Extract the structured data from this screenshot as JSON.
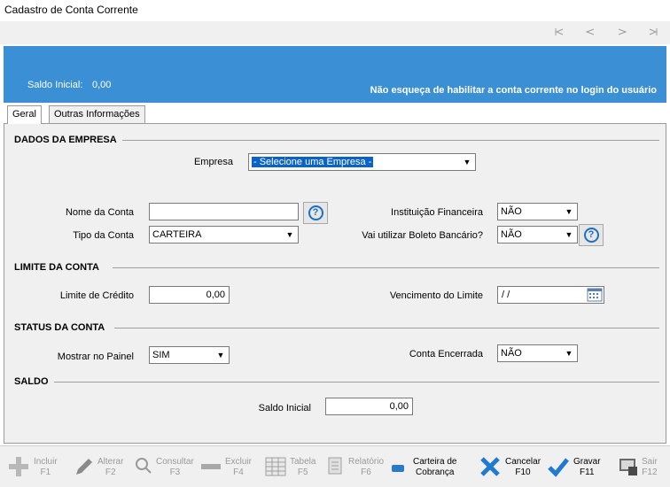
{
  "window": {
    "title": "Cadastro de Conta Corrente"
  },
  "navigation": {
    "icons": [
      "first-record-icon",
      "previous-record-icon",
      "next-record-icon",
      "last-record-icon"
    ]
  },
  "banner": {
    "saldo_label": "Saldo Inicial:",
    "saldo_value": "0,00",
    "warning": "Não esqueça de habilitar a conta corrente no login do usuário",
    "color": "#3b8fd5"
  },
  "tabs": [
    {
      "label": "Geral",
      "active": true
    },
    {
      "label": "Outras Informações",
      "active": false
    }
  ],
  "sections": {
    "empresa": "DADOS DA EMPRESA",
    "limite": "LIMITE DA CONTA",
    "status": "STATUS DA CONTA",
    "saldo": "SALDO"
  },
  "form": {
    "empresa": {
      "label": "Empresa",
      "value": "- Selecione uma Empresa -"
    },
    "nome_conta": {
      "label": "Nome da Conta",
      "value": ""
    },
    "tipo_conta": {
      "label": "Tipo da Conta",
      "value": "CARTEIRA"
    },
    "instituicao_financeira": {
      "label": "Instituição Financeira",
      "value": "NÃO"
    },
    "boleto_bancario": {
      "label": "Vai utilizar Boleto Bancário?",
      "value": "NÃO"
    },
    "limite_credito": {
      "label": "Limite de Crédito",
      "value": "0,00"
    },
    "vencimento_limite": {
      "label": "Vencimento do Limite",
      "value": " /  /"
    },
    "mostrar_painel": {
      "label": "Mostrar no Painel",
      "value": "SIM"
    },
    "conta_encerrada": {
      "label": "Conta Encerrada",
      "value": "NÃO"
    },
    "saldo_inicial": {
      "label": "Saldo Inicial",
      "value": "0,00"
    }
  },
  "toolbar": {
    "incluir": {
      "label": "Incluir",
      "key": "F1"
    },
    "alterar": {
      "label": "Alterar",
      "key": "F2"
    },
    "consultar": {
      "label": "Consultar",
      "key": "F3"
    },
    "excluir": {
      "label": "Excluir",
      "key": "F4"
    },
    "tabela": {
      "label": "Tabela",
      "key": "F5"
    },
    "relatorio": {
      "label": "Relatório",
      "key": "F6"
    },
    "carteira": {
      "label": "Carteira de",
      "label2": "Cobrança"
    },
    "cancelar": {
      "label": "Cancelar",
      "key": "F10"
    },
    "gravar": {
      "label": "Gravar",
      "key": "F11"
    },
    "sair": {
      "label": "Sair",
      "key": "F12"
    }
  }
}
